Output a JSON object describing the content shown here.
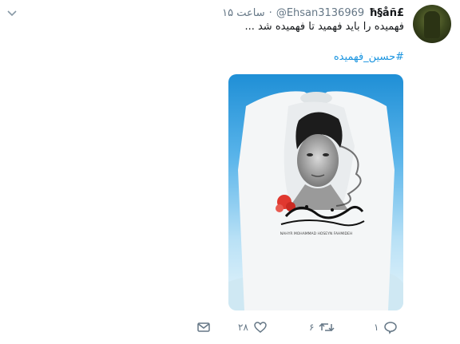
{
  "tweet": {
    "display_name": "ħ§åñ£",
    "handle": "@Ehsan3136969",
    "time": "۱۵ ساعت",
    "separator": "·",
    "text": "فهمیده را باید فهمید تا فهمیده شد ...",
    "hashtag": "#حسین_فهمیده"
  },
  "media": {
    "caption_latin": "NAHYR MOHAMMAD HOSEYN FAHMIDEH"
  },
  "actions": {
    "reply_count": "۱",
    "retweet_count": "۶",
    "like_count": "۲۸"
  },
  "icons": [
    "chevron-down-icon",
    "reply-icon",
    "retweet-icon",
    "like-icon",
    "dm-icon"
  ],
  "colors": {
    "link": "#1b95e0",
    "muted": "#657786",
    "text": "#14171a"
  }
}
